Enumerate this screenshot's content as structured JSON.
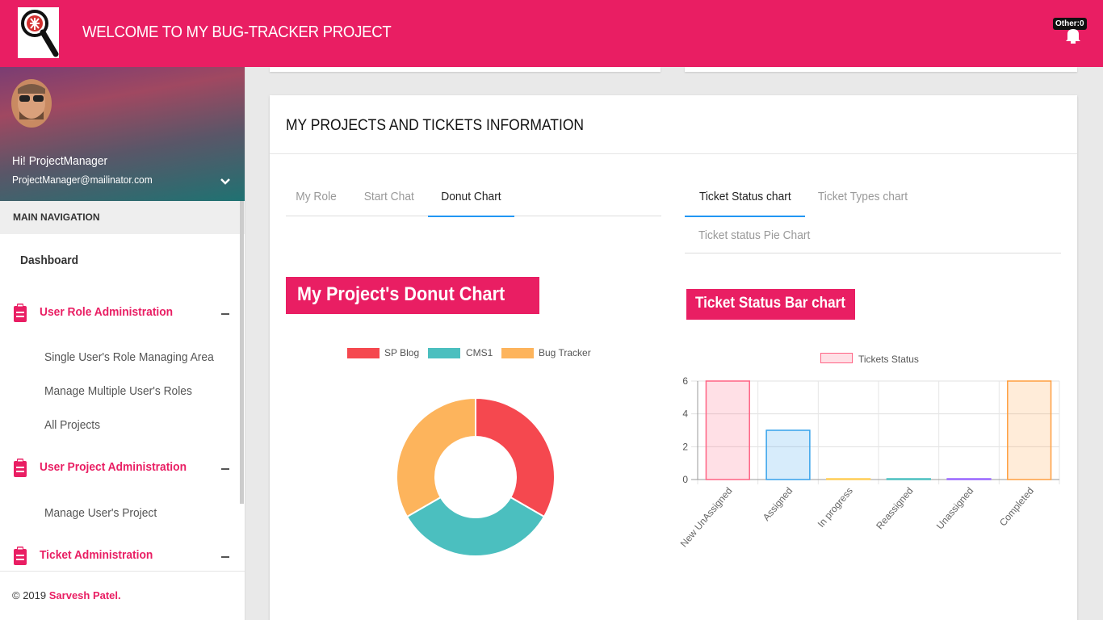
{
  "header": {
    "title": "WELCOME TO MY BUG-TRACKER PROJECT",
    "notification_badge": "Other:0"
  },
  "sidebar": {
    "user_greeting": "Hi! ProjectManager",
    "user_email": "ProjectManager@mailinator.com",
    "nav_header": "MAIN NAVIGATION",
    "dashboard": "Dashboard",
    "sections": [
      {
        "label": "User Role Administration",
        "items": [
          "Single User's Role Managing Area",
          "Manage Multiple User's Roles",
          "All Projects"
        ]
      },
      {
        "label": "User Project Administration",
        "items": [
          "Manage User's Project"
        ]
      },
      {
        "label": "Ticket Administration",
        "items": []
      }
    ],
    "footer_copyright": "© 2019",
    "footer_author": "Sarvesh Patel."
  },
  "main": {
    "card_title": "MY PROJECTS AND TICKETS INFORMATION",
    "left_tabs": [
      "My Role",
      "Start Chat",
      "Donut Chart"
    ],
    "left_active_tab": "Donut Chart",
    "right_tabs": [
      "Ticket Status chart",
      "Ticket Types chart",
      "Ticket status Pie Chart"
    ],
    "right_active_tab": "Ticket Status chart",
    "donut_heading": "My Project's Donut Chart",
    "bar_heading": "Ticket Status Bar chart"
  },
  "colors": {
    "brand": "#e91e63",
    "tab_active": "#2196f3"
  },
  "chart_data": [
    {
      "type": "pie",
      "title": "My Project's Donut Chart",
      "categories": [
        "SP Blog",
        "CMS1",
        "Bug Tracker"
      ],
      "values": [
        1,
        1,
        1
      ],
      "colors": [
        "#f5484f",
        "#4bbfbf",
        "#fdb45c"
      ],
      "legend": "top"
    },
    {
      "type": "bar",
      "title": "Ticket Status Bar chart",
      "categories": [
        "New UnAssigned",
        "Assigned",
        "In progress",
        "Reassigned",
        "Unassigned",
        "Completed"
      ],
      "series": [
        {
          "name": "Tickets Status",
          "values": [
            6,
            3,
            0,
            0,
            0,
            6
          ]
        }
      ],
      "ylim": [
        0,
        6
      ],
      "yticks": [
        0,
        2,
        4,
        6
      ],
      "grid": true,
      "legend": "top",
      "bar_fill": [
        "rgba(255,99,132,0.2)",
        "rgba(54,162,235,0.2)",
        "rgba(255,206,86,0.2)",
        "rgba(75,192,192,0.2)",
        "rgba(153,102,255,0.2)",
        "rgba(255,159,64,0.2)"
      ],
      "bar_border": [
        "#ff6384",
        "#36a2eb",
        "#ffce56",
        "#4bc0c0",
        "#9966ff",
        "#ff9f40"
      ]
    }
  ]
}
